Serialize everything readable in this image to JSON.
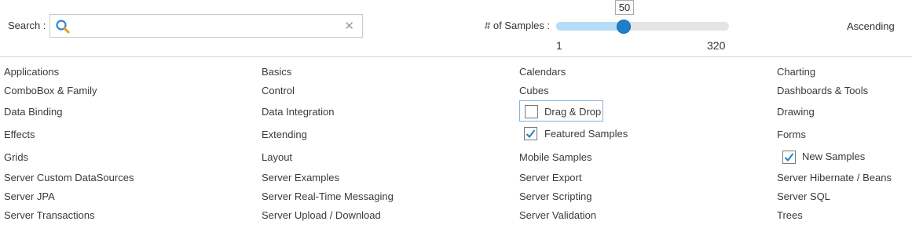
{
  "search": {
    "label": "Search :",
    "value": "",
    "placeholder": ""
  },
  "samples": {
    "label": "# of Samples :",
    "min": "1",
    "max": "320",
    "value": "50",
    "min_num": 1,
    "max_num": 320,
    "value_num": 50
  },
  "sort": {
    "label": "Ascending"
  },
  "categories": {
    "applications": "Applications",
    "basics": "Basics",
    "calendars": "Calendars",
    "charting": "Charting",
    "combobox": "ComboBox & Family",
    "control": "Control",
    "cubes": "Cubes",
    "dashboards": "Dashboards & Tools",
    "data_binding": "Data Binding",
    "data_integration": "Data Integration",
    "drag_drop": "Drag & Drop",
    "drawing": "Drawing",
    "effects": "Effects",
    "extending": "Extending",
    "featured": "Featured Samples",
    "forms": "Forms",
    "grids": "Grids",
    "layout": "Layout",
    "mobile": "Mobile Samples",
    "new_samples": "New Samples",
    "server_custom": "Server Custom DataSources",
    "server_examples": "Server Examples",
    "server_export": "Server Export",
    "server_hibernate": "Server Hibernate / Beans",
    "server_jpa": "Server JPA",
    "server_realtime": "Server Real-Time Messaging",
    "server_scripting": "Server Scripting",
    "server_sql": "Server SQL",
    "server_transactions": "Server Transactions",
    "server_upload": "Server Upload / Download",
    "server_validation": "Server Validation",
    "trees": "Trees"
  },
  "checks": {
    "drag_drop": false,
    "featured": true,
    "new_samples": true
  },
  "colors": {
    "accent": "#1f80c9",
    "track": "#e4e4e4",
    "fill": "#b7dcf5",
    "check": "#1f80c9"
  },
  "icons": {
    "search": "search-icon",
    "clear": "clear-icon",
    "check": "checkmark-icon"
  }
}
